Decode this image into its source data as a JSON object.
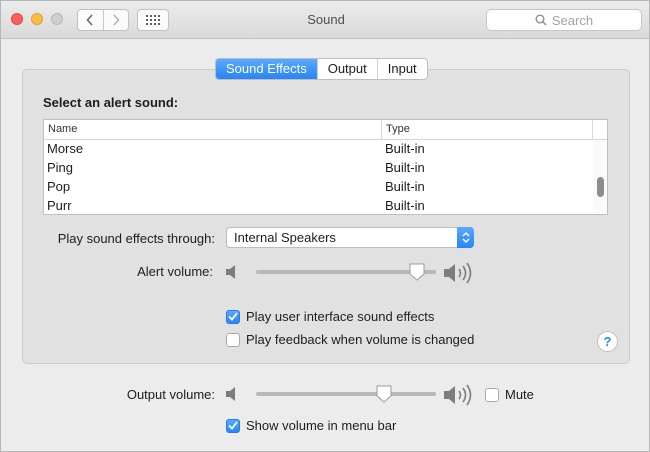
{
  "window": {
    "title": "Sound",
    "search": {
      "placeholder": "Search"
    }
  },
  "tabs": [
    {
      "label": "Sound Effects",
      "active": true
    },
    {
      "label": "Output",
      "active": false
    },
    {
      "label": "Input",
      "active": false
    }
  ],
  "alert_sound": {
    "heading": "Select an alert sound:",
    "columns": {
      "name": "Name",
      "type": "Type"
    },
    "rows": [
      {
        "name": "Morse",
        "type": "Built-in"
      },
      {
        "name": "Ping",
        "type": "Built-in"
      },
      {
        "name": "Pop",
        "type": "Built-in"
      },
      {
        "name": "Purr",
        "type": "Built-in"
      }
    ]
  },
  "play_through": {
    "label": "Play sound effects through:",
    "selected": "Internal Speakers"
  },
  "alert_volume": {
    "label": "Alert volume:",
    "level": 0.93
  },
  "checkboxes": {
    "ui_sounds": {
      "label": "Play user interface sound effects",
      "checked": true
    },
    "feedback": {
      "label": "Play feedback when volume is changed",
      "checked": false
    },
    "mute": {
      "label": "Mute",
      "checked": false
    },
    "menu_bar": {
      "label": "Show volume in menu bar",
      "checked": true
    }
  },
  "output_volume": {
    "label": "Output volume:",
    "level": 0.73
  },
  "help": {
    "label": "?"
  },
  "colors": {
    "accent": "#2785f6",
    "window_bg": "#ececec",
    "panel_bg": "#e1e1e1"
  },
  "icons": {
    "back": "chevron-left-icon",
    "forward": "chevron-right-icon",
    "show_all": "grid-icon",
    "search": "search-icon",
    "volume_low": "speaker-low-icon",
    "volume_high": "speaker-high-icon"
  }
}
